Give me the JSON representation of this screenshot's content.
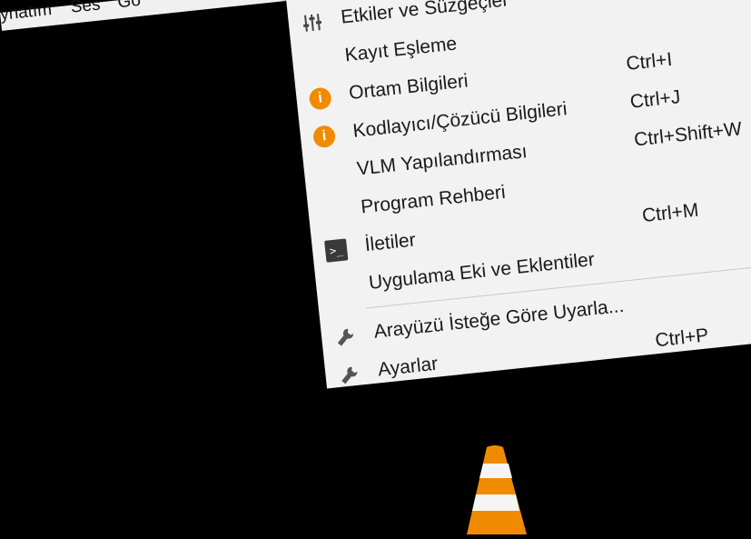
{
  "menubar": {
    "items": [
      "ynatım",
      "Ses",
      "Gö"
    ]
  },
  "menu": {
    "items": [
      {
        "label": "Etkiler ve Süzgeçler",
        "shortcut": "",
        "icon": "sliders-icon"
      },
      {
        "label": "Kayıt Eşleme",
        "shortcut": "",
        "icon": ""
      },
      {
        "label": "Ortam Bilgileri",
        "shortcut": "Ctrl+I",
        "icon": "info-icon"
      },
      {
        "label": "Kodlayıcı/Çözücü Bilgileri",
        "shortcut": "Ctrl+J",
        "icon": "info-icon"
      },
      {
        "label": "VLM Yapılandırması",
        "shortcut": "Ctrl+Shift+W",
        "icon": ""
      },
      {
        "label": "Program Rehberi",
        "shortcut": "",
        "icon": ""
      },
      {
        "label": "İletiler",
        "shortcut": "Ctrl+M",
        "icon": "terminal-icon"
      },
      {
        "label": "Uygulama Eki ve Eklentiler",
        "shortcut": "",
        "icon": ""
      },
      {
        "label": "Arayüzü İsteğe Göre Uyarla...",
        "shortcut": "",
        "icon": "wrench-icon"
      },
      {
        "label": "Ayarlar",
        "shortcut": "Ctrl+P",
        "icon": "wrench-icon"
      }
    ]
  },
  "colors": {
    "accent": "#f08b00",
    "menu_bg": "#f2f2f2",
    "background": "#000000"
  }
}
